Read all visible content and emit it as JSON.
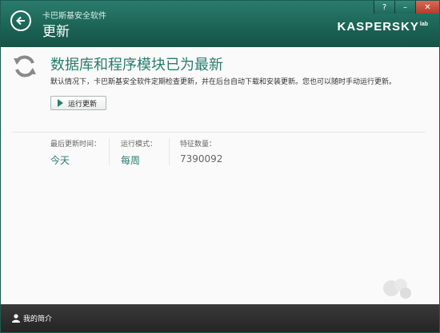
{
  "window": {
    "app_name": "卡巴斯基安全软件",
    "screen_title": "更新",
    "logo": "KASPERSKY",
    "logo_suffix": "lab",
    "controls": {
      "help": "?",
      "minimize": "–",
      "close": "✕"
    }
  },
  "update": {
    "headline": "数据库和程序模块已为最新",
    "description": "默认情况下，卡巴斯基安全软件定期检查更新，并在后台自动下载和安装更新。您也可以随时手动运行更新。",
    "run_button_label": "运行更新"
  },
  "stats": [
    {
      "label": "最后更新时间：",
      "value": "今天"
    },
    {
      "label": "运行模式：",
      "value": "每周"
    },
    {
      "label": "特征数量：",
      "value": "7390092"
    }
  ],
  "footer": {
    "profile_label": "我的简介"
  },
  "colors": {
    "brand": "#1b6254",
    "accent": "#2a7c6d",
    "footer": "#2a2a2a"
  },
  "icons": {
    "back": "back-arrow-icon",
    "refresh": "refresh-icon",
    "play": "play-icon",
    "user": "user-icon"
  }
}
